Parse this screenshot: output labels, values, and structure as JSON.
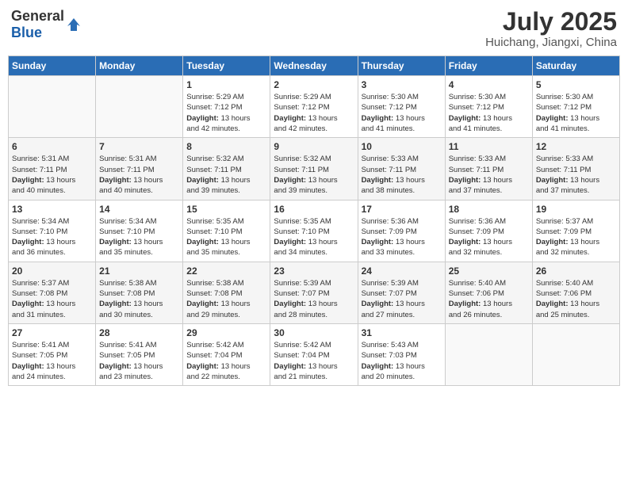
{
  "header": {
    "logo_general": "General",
    "logo_blue": "Blue",
    "title": "July 2025",
    "subtitle": "Huichang, Jiangxi, China"
  },
  "weekdays": [
    "Sunday",
    "Monday",
    "Tuesday",
    "Wednesday",
    "Thursday",
    "Friday",
    "Saturday"
  ],
  "weeks": [
    [
      {
        "day": "",
        "info": ""
      },
      {
        "day": "",
        "info": ""
      },
      {
        "day": "1",
        "info": "Sunrise: 5:29 AM\nSunset: 7:12 PM\nDaylight: 13 hours\nand 42 minutes."
      },
      {
        "day": "2",
        "info": "Sunrise: 5:29 AM\nSunset: 7:12 PM\nDaylight: 13 hours\nand 42 minutes."
      },
      {
        "day": "3",
        "info": "Sunrise: 5:30 AM\nSunset: 7:12 PM\nDaylight: 13 hours\nand 41 minutes."
      },
      {
        "day": "4",
        "info": "Sunrise: 5:30 AM\nSunset: 7:12 PM\nDaylight: 13 hours\nand 41 minutes."
      },
      {
        "day": "5",
        "info": "Sunrise: 5:30 AM\nSunset: 7:12 PM\nDaylight: 13 hours\nand 41 minutes."
      }
    ],
    [
      {
        "day": "6",
        "info": "Sunrise: 5:31 AM\nSunset: 7:11 PM\nDaylight: 13 hours\nand 40 minutes."
      },
      {
        "day": "7",
        "info": "Sunrise: 5:31 AM\nSunset: 7:11 PM\nDaylight: 13 hours\nand 40 minutes."
      },
      {
        "day": "8",
        "info": "Sunrise: 5:32 AM\nSunset: 7:11 PM\nDaylight: 13 hours\nand 39 minutes."
      },
      {
        "day": "9",
        "info": "Sunrise: 5:32 AM\nSunset: 7:11 PM\nDaylight: 13 hours\nand 39 minutes."
      },
      {
        "day": "10",
        "info": "Sunrise: 5:33 AM\nSunset: 7:11 PM\nDaylight: 13 hours\nand 38 minutes."
      },
      {
        "day": "11",
        "info": "Sunrise: 5:33 AM\nSunset: 7:11 PM\nDaylight: 13 hours\nand 37 minutes."
      },
      {
        "day": "12",
        "info": "Sunrise: 5:33 AM\nSunset: 7:11 PM\nDaylight: 13 hours\nand 37 minutes."
      }
    ],
    [
      {
        "day": "13",
        "info": "Sunrise: 5:34 AM\nSunset: 7:10 PM\nDaylight: 13 hours\nand 36 minutes."
      },
      {
        "day": "14",
        "info": "Sunrise: 5:34 AM\nSunset: 7:10 PM\nDaylight: 13 hours\nand 35 minutes."
      },
      {
        "day": "15",
        "info": "Sunrise: 5:35 AM\nSunset: 7:10 PM\nDaylight: 13 hours\nand 35 minutes."
      },
      {
        "day": "16",
        "info": "Sunrise: 5:35 AM\nSunset: 7:10 PM\nDaylight: 13 hours\nand 34 minutes."
      },
      {
        "day": "17",
        "info": "Sunrise: 5:36 AM\nSunset: 7:09 PM\nDaylight: 13 hours\nand 33 minutes."
      },
      {
        "day": "18",
        "info": "Sunrise: 5:36 AM\nSunset: 7:09 PM\nDaylight: 13 hours\nand 32 minutes."
      },
      {
        "day": "19",
        "info": "Sunrise: 5:37 AM\nSunset: 7:09 PM\nDaylight: 13 hours\nand 32 minutes."
      }
    ],
    [
      {
        "day": "20",
        "info": "Sunrise: 5:37 AM\nSunset: 7:08 PM\nDaylight: 13 hours\nand 31 minutes."
      },
      {
        "day": "21",
        "info": "Sunrise: 5:38 AM\nSunset: 7:08 PM\nDaylight: 13 hours\nand 30 minutes."
      },
      {
        "day": "22",
        "info": "Sunrise: 5:38 AM\nSunset: 7:08 PM\nDaylight: 13 hours\nand 29 minutes."
      },
      {
        "day": "23",
        "info": "Sunrise: 5:39 AM\nSunset: 7:07 PM\nDaylight: 13 hours\nand 28 minutes."
      },
      {
        "day": "24",
        "info": "Sunrise: 5:39 AM\nSunset: 7:07 PM\nDaylight: 13 hours\nand 27 minutes."
      },
      {
        "day": "25",
        "info": "Sunrise: 5:40 AM\nSunset: 7:06 PM\nDaylight: 13 hours\nand 26 minutes."
      },
      {
        "day": "26",
        "info": "Sunrise: 5:40 AM\nSunset: 7:06 PM\nDaylight: 13 hours\nand 25 minutes."
      }
    ],
    [
      {
        "day": "27",
        "info": "Sunrise: 5:41 AM\nSunset: 7:05 PM\nDaylight: 13 hours\nand 24 minutes."
      },
      {
        "day": "28",
        "info": "Sunrise: 5:41 AM\nSunset: 7:05 PM\nDaylight: 13 hours\nand 23 minutes."
      },
      {
        "day": "29",
        "info": "Sunrise: 5:42 AM\nSunset: 7:04 PM\nDaylight: 13 hours\nand 22 minutes."
      },
      {
        "day": "30",
        "info": "Sunrise: 5:42 AM\nSunset: 7:04 PM\nDaylight: 13 hours\nand 21 minutes."
      },
      {
        "day": "31",
        "info": "Sunrise: 5:43 AM\nSunset: 7:03 PM\nDaylight: 13 hours\nand 20 minutes."
      },
      {
        "day": "",
        "info": ""
      },
      {
        "day": "",
        "info": ""
      }
    ]
  ]
}
